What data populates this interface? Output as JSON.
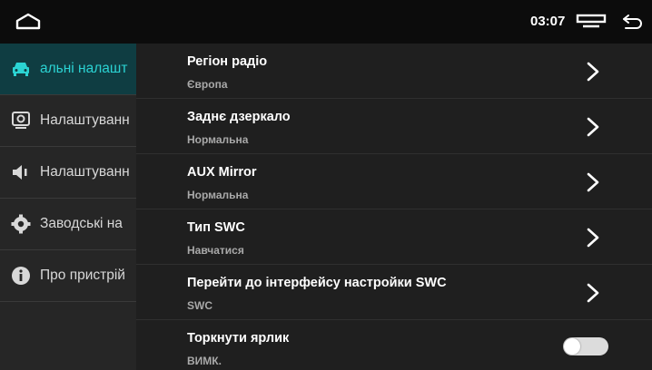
{
  "statusbar": {
    "time": "03:07",
    "icons": [
      "home-icon",
      "recents-icon",
      "back-icon"
    ]
  },
  "sidebar": {
    "items": [
      {
        "label": "альні налашт",
        "icon": "car-icon",
        "active": true
      },
      {
        "label": "Налаштуванн",
        "icon": "display-settings-icon",
        "active": false
      },
      {
        "label": "Налаштуванн",
        "icon": "speaker-icon",
        "active": false
      },
      {
        "label": "Заводські на",
        "icon": "gear-icon",
        "active": false
      },
      {
        "label": "Про пристрій",
        "icon": "info-icon",
        "active": false
      }
    ]
  },
  "settings": {
    "rows": [
      {
        "title": "Регіон радіо",
        "value": "Європа"
      },
      {
        "title": "Заднє дзеркало",
        "value": "Нормальна"
      },
      {
        "title": "AUX Mirror",
        "value": "Нормальна"
      },
      {
        "title": "Тип SWC",
        "value": "Навчатися"
      },
      {
        "title": "Перейти до інтерфейсу настройки SWC",
        "value": "SWC"
      },
      {
        "title": "Торкнути ярлик",
        "value": "ВИМК.",
        "toggle_on": false
      }
    ]
  },
  "colors": {
    "accent": "#2bd3d3",
    "active_bg": "#0f3d42",
    "sidebar_bg": "#262626",
    "content_bg": "#1f1f1f"
  }
}
